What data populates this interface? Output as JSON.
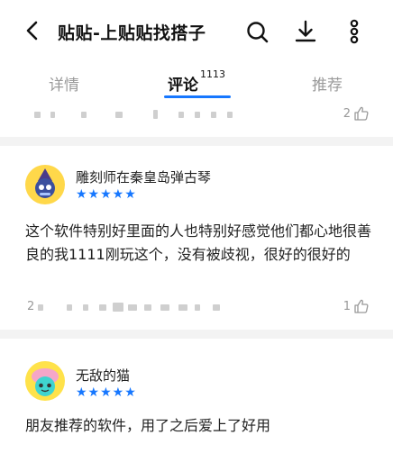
{
  "header": {
    "title": "贴贴-上贴贴找搭子"
  },
  "tabs": {
    "detail": "详情",
    "comments": "评论",
    "comments_count": "1113",
    "recommend": "推荐"
  },
  "colors": {
    "accent": "#1677ff"
  },
  "icons": [
    "back-arrow-icon",
    "search-icon",
    "download-icon",
    "more-vertical-icon",
    "thumb-up-icon"
  ],
  "reviews": [
    {
      "like_count": "2"
    },
    {
      "user": "雕刻师在秦皇岛弹古琴",
      "rating": 5,
      "stars": "★★★★★",
      "content": "这个软件特别好里面的人也特别好感觉他们都心地很善良的我1111刚玩这个，没有被歧视，很好的很好的",
      "meta_prefix": "2",
      "like_count": "1"
    },
    {
      "user": "无敌的猫",
      "rating": 5,
      "stars": "★★★★★",
      "content": "朋友推荐的软件，用了之后爱上了好用"
    }
  ]
}
